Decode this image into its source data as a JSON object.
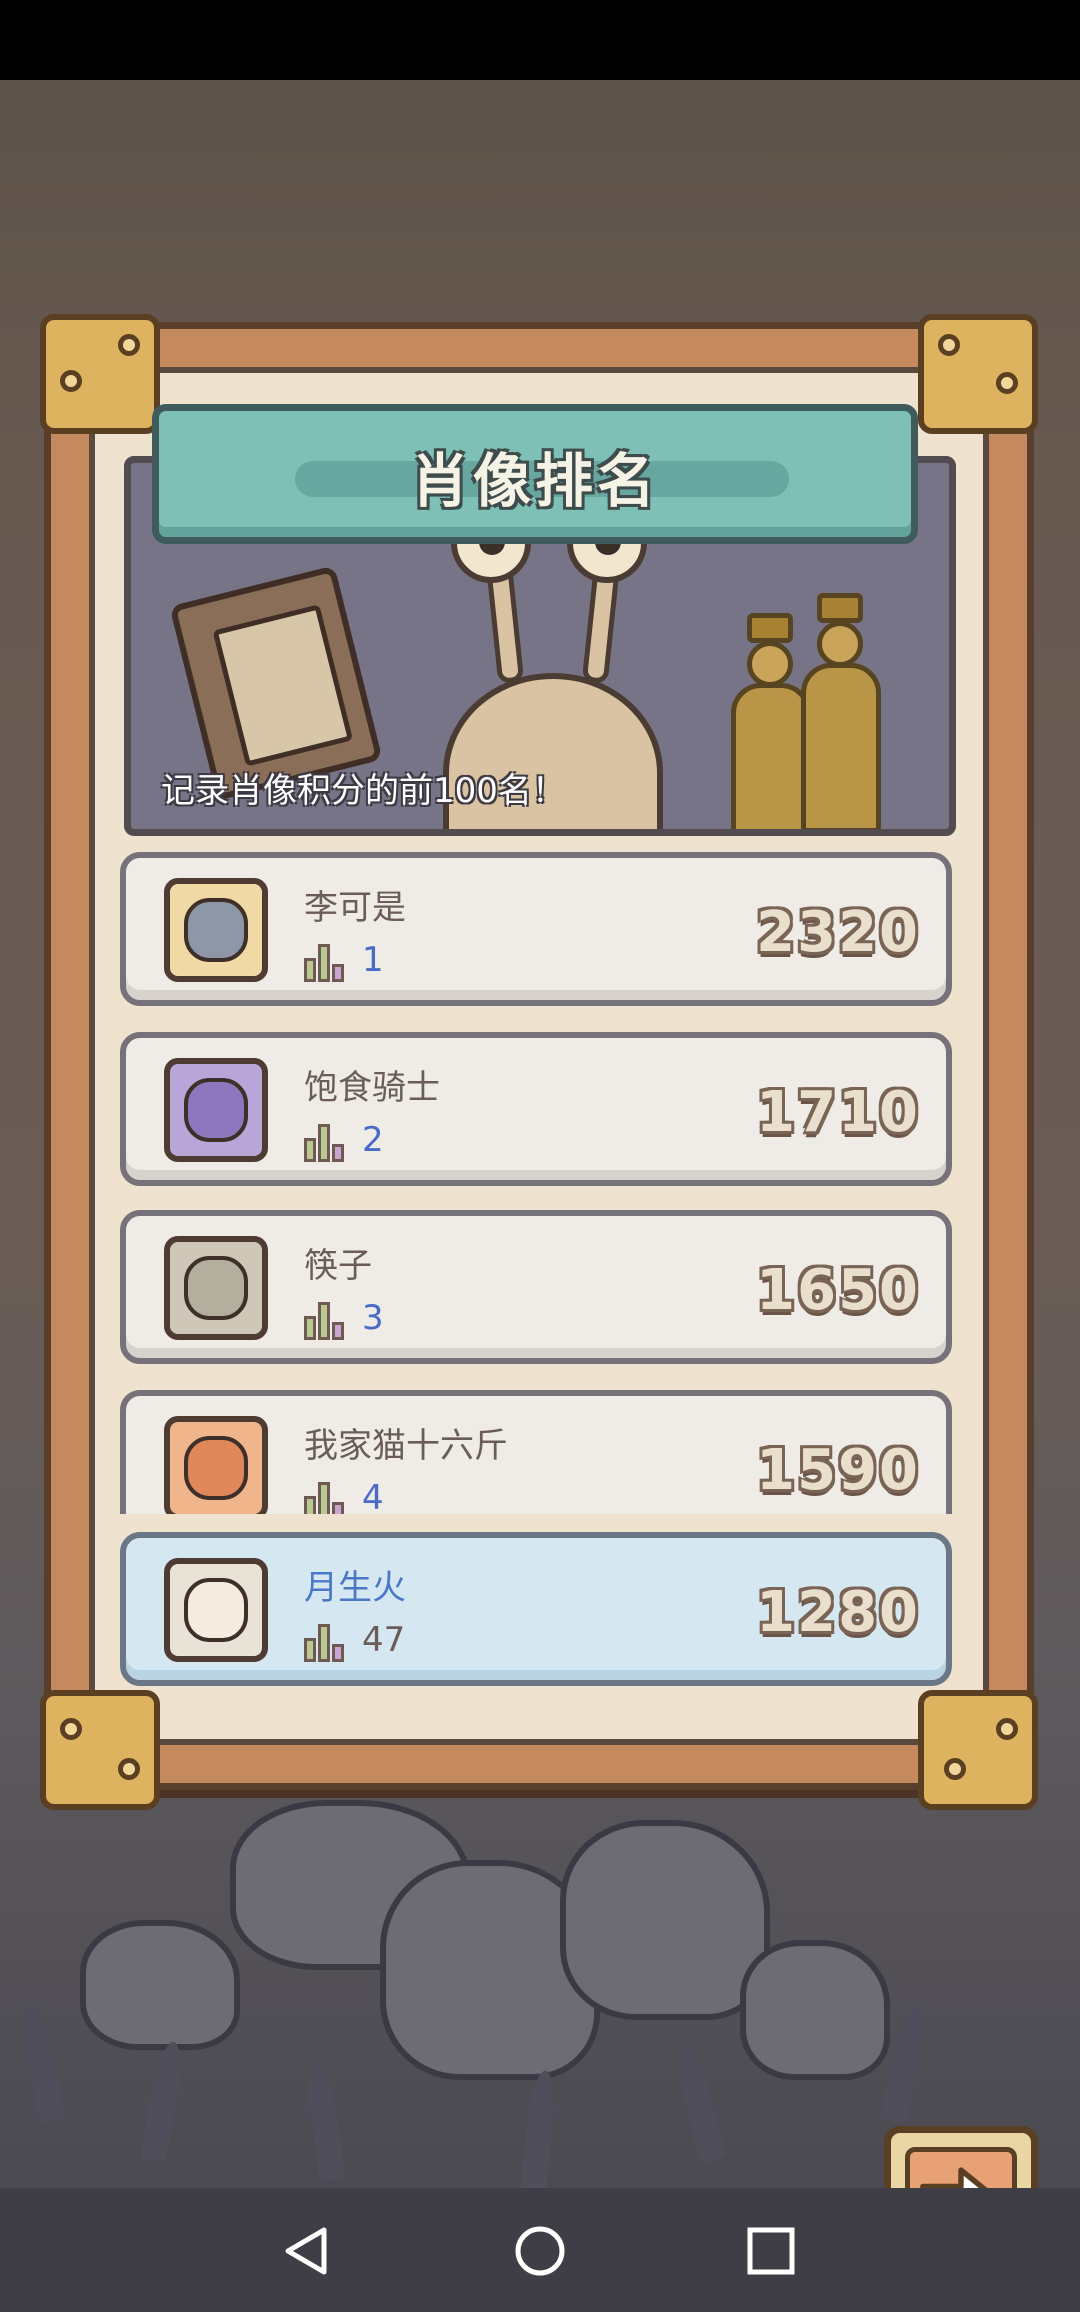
{
  "banner": {
    "title": "肖像排名",
    "subtitle": "记录肖像积分的前100名！"
  },
  "leaderboard": [
    {
      "name": "李可是",
      "rank": "1",
      "score": "2320",
      "avatar": "shark-avatar-icon"
    },
    {
      "name": "饱食骑士",
      "rank": "2",
      "score": "1710",
      "avatar": "dragon-avatar-icon"
    },
    {
      "name": "筷子",
      "rank": "3",
      "score": "1650",
      "avatar": "knight-avatar-icon"
    },
    {
      "name": "我家猫十六斤",
      "rank": "4",
      "score": "1590",
      "avatar": "cat-avatar-icon"
    }
  ],
  "current_player": {
    "name": "月生火",
    "rank": "47",
    "score": "1280",
    "avatar": "girl-avatar-icon"
  },
  "next_button": {
    "icon": "arrow-right-icon"
  },
  "nav": {
    "back": "back-icon",
    "home": "home-icon",
    "recent": "recent-apps-icon"
  },
  "colors": {
    "name_highlight": "#4a78c7",
    "rank_number": "#4a6ac8",
    "panel_frame": "#c4895c",
    "title_board": "#7fc0b6"
  }
}
